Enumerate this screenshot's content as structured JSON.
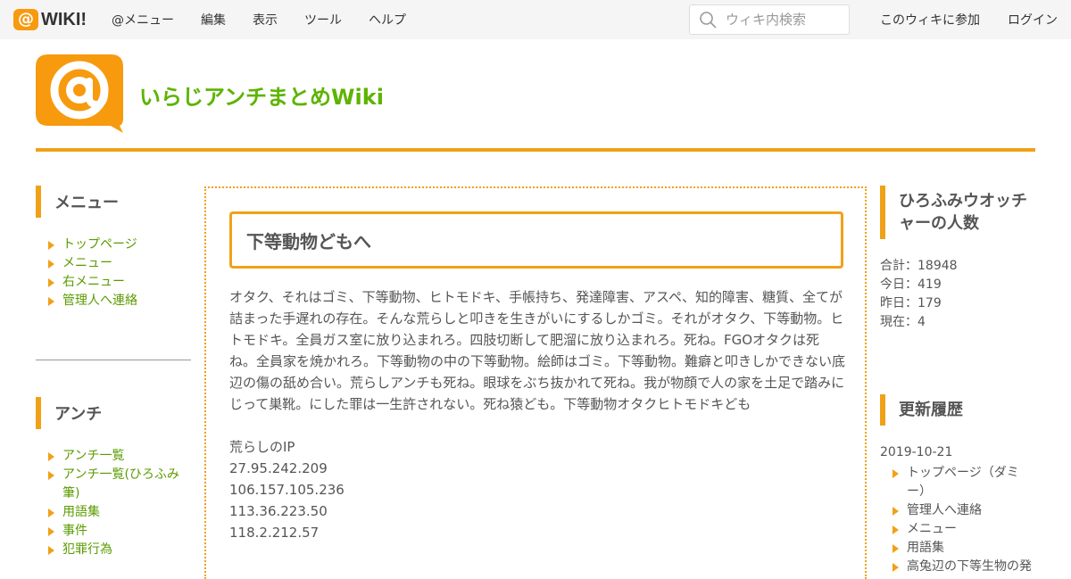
{
  "topbar": {
    "brand_word": "WIKI!",
    "nav": [
      "@メニュー",
      "編集",
      "表示",
      "ツール",
      "ヘルプ"
    ],
    "search_placeholder": "ウィキ内検索",
    "join": "このウィキに参加",
    "login": "ログイン",
    "icons": {
      "brand": "atwiki-logo-icon",
      "search": "search-icon"
    }
  },
  "site": {
    "title": "いらじアンチまとめWiki",
    "accent_color": "#f0a118",
    "title_color": "#5db400"
  },
  "left_sidebar": {
    "menu_heading": "メニュー",
    "menu_items": [
      "トップページ",
      "メニュー",
      "右メニュー",
      "管理人へ連絡"
    ],
    "anti_heading": "アンチ",
    "anti_items": [
      "アンチ一覧",
      "アンチ一覧(ひろふみ筆)",
      "用語集",
      "事件",
      "犯罪行為"
    ]
  },
  "main": {
    "page_title": "下等動物どもへ",
    "paragraph": "オタク、それはゴミ、下等動物、ヒトモドキ、手帳持ち、発達障害、アスペ、知的障害、糖質、全てが詰まった手遅れの存在。そんな荒らしと叩きを生きがいにするしかゴミ。それがオタク、下等動物。ヒトモドキ。全員ガス室に放り込まれろ。四肢切断して肥溜に放り込まれろ。死ね。FGOオタクは死ね。全員家を焼かれろ。下等動物の中の下等動物。絵師はゴミ。下等動物。難癖と叩きしかできない底辺の傷の舐め合い。荒らしアンチも死ね。眼球をぶち抜かれて死ね。我が物顔で人の家を土足で踏みにじって巣靴。にした罪は一生許されない。死ね猿ども。下等動物オタクヒトモドキども",
    "ip_heading": "荒らしのIP",
    "ips": [
      "27.95.242.209",
      "106.157.105.236",
      "113.36.223.50",
      "118.2.212.57"
    ]
  },
  "right_sidebar": {
    "counter_heading": "ひろふみウオッチャーの人数",
    "counters": [
      {
        "label": "合計：",
        "value": "18948"
      },
      {
        "label": "今日：",
        "value": "419"
      },
      {
        "label": "昨日：",
        "value": "179"
      },
      {
        "label": "現在：",
        "value": "4"
      }
    ],
    "history_heading": "更新履歴",
    "history_date": "2019-10-21",
    "history_items": [
      "トップページ（ダミー）",
      "管理人へ連絡",
      "メニュー",
      "用語集",
      "高兔辺の下等生物の発"
    ]
  }
}
